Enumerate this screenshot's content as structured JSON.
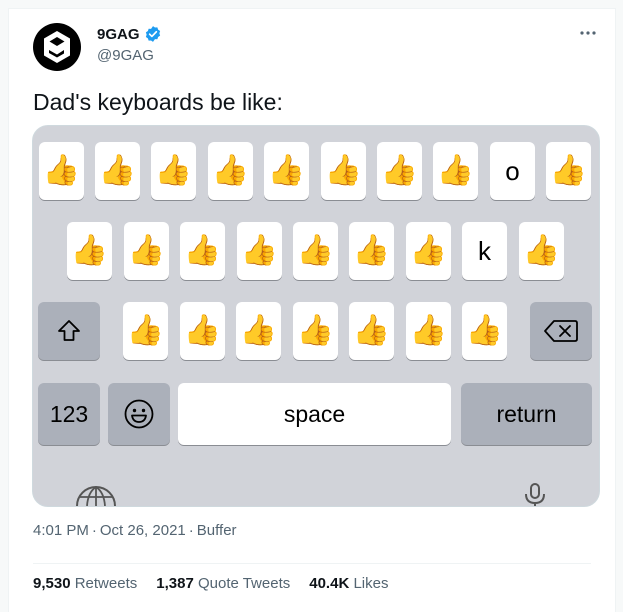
{
  "author": {
    "name": "9GAG",
    "handle": "@9GAG",
    "verified": true
  },
  "tweet": {
    "text": "Dad's keyboards be like:"
  },
  "keyboard": {
    "row1": [
      "👍",
      "👍",
      "👍",
      "👍",
      "👍",
      "👍",
      "👍",
      "👍",
      "o",
      "👍"
    ],
    "row2": [
      "👍",
      "👍",
      "👍",
      "👍",
      "👍",
      "👍",
      "👍",
      "k",
      "👍"
    ],
    "row3": [
      "👍",
      "👍",
      "👍",
      "👍",
      "👍",
      "👍",
      "👍"
    ],
    "numbers_label": "123",
    "space_label": "space",
    "return_label": "return"
  },
  "meta": {
    "time": "4:01 PM",
    "date": "Oct 26, 2021",
    "source": "Buffer"
  },
  "stats": {
    "retweets": "9,530",
    "retweets_label": "Retweets",
    "quotes": "1,387",
    "quotes_label": "Quote Tweets",
    "likes": "40.4K",
    "likes_label": "Likes"
  },
  "colors": {
    "keyboard_bg": "#d1d3d9",
    "dark_key": "#abb0ba",
    "verified": "#1d9bf0"
  }
}
